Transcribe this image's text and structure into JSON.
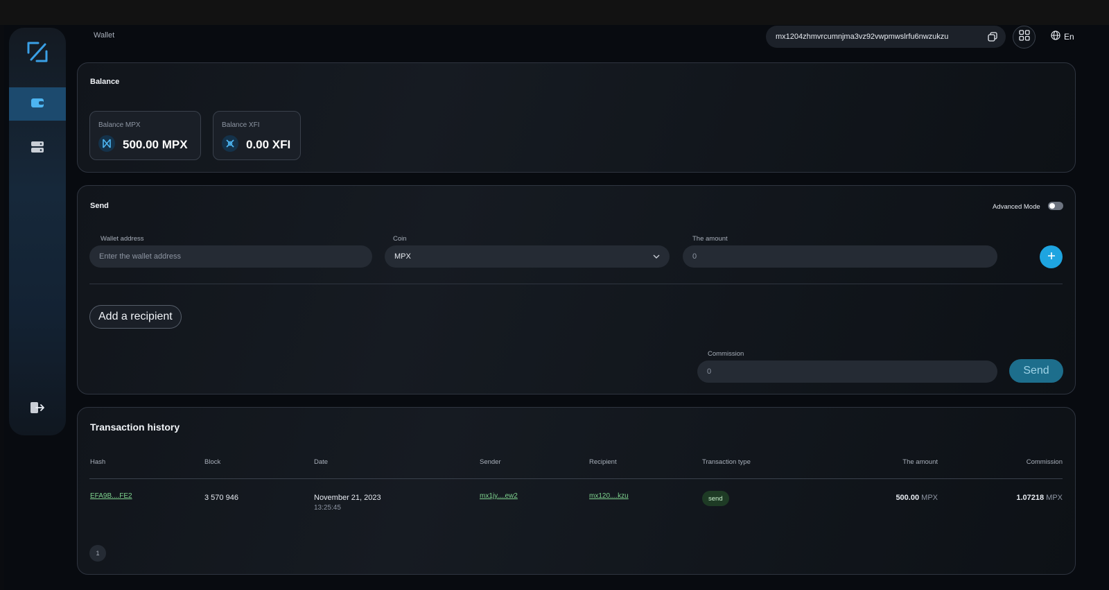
{
  "header": {
    "crumb": "Wallet",
    "address": "mx1204zhmvrcumnjma3vz92vwpmwslrfu6nwzukzu",
    "language": "En"
  },
  "balance": {
    "title": "Balance",
    "cards": [
      {
        "label": "Balance MPX",
        "value": "500.00 MPX"
      },
      {
        "label": "Balance XFI",
        "value": "0.00 XFI"
      }
    ]
  },
  "send": {
    "title": "Send",
    "advanced_mode_label": "Advanced Mode",
    "advanced_mode_on": false,
    "wallet_label": "Wallet address",
    "wallet_placeholder": "Enter the wallet address",
    "coin_label": "Coin",
    "coin_value": "MPX",
    "amount_label": "The amount",
    "amount_value": "0",
    "add_recipient": "Add a recipient",
    "commission_label": "Commission",
    "commission_value": "0",
    "send_label": "Send"
  },
  "history": {
    "title": "Transaction history",
    "columns": [
      "Hash",
      "Block",
      "Date",
      "Sender",
      "Recipient",
      "Transaction type",
      "The amount",
      "Commission"
    ],
    "rows": [
      {
        "hash": "EFA9B....FE2",
        "block": "3 570 946",
        "date": "November 21, 2023",
        "time": "13:25:45",
        "sender": "mx1jy....ew2",
        "recipient": "mx120....kzu",
        "type": "send",
        "amount": "500.00",
        "amount_unit": "MPX",
        "commission": "1.07218",
        "commission_unit": "MPX"
      }
    ],
    "page": "1"
  },
  "colors": {
    "accent": "#1ea4e0",
    "link": "#7fd48f",
    "badge_bg": "#1e3b25"
  },
  "icons": [
    "logo-icon",
    "wallet-icon",
    "server-icon",
    "logout-icon",
    "copy-icon",
    "qr-icon",
    "globe-icon",
    "mpx-coin-icon",
    "xfi-coin-icon",
    "chevron-down-icon",
    "plus-icon"
  ]
}
